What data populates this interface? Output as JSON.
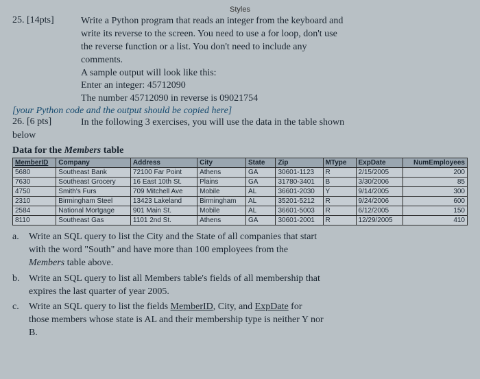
{
  "tab": "Styles",
  "q25": {
    "num": "25. [14pts]",
    "l1": "Write a Python program that reads an integer from the keyboard and",
    "l2": "write its reverse to the screen.  You need to use a for loop, don't use",
    "l3": "the reverse function or a list. You don't need to include any",
    "l4": "comments.",
    "l5": "A sample output will look like this:",
    "l6": "Enter an integer: 45712090",
    "l7": "The number 45712090 in reverse is 09021754",
    "note": "[your Python code and the output should be copied here]"
  },
  "q26": {
    "num": "26. [6 pts]",
    "l1": "In the following 3 exercises, you will use the data in the table shown",
    "below": "below",
    "heading_pre": "Data for the ",
    "heading_tbl": "Members",
    "heading_post": " table"
  },
  "headers": {
    "c0": "MemberID",
    "c1": "Company",
    "c2": "Address",
    "c3": "City",
    "c4": "State",
    "c5": "Zip",
    "c6": "MType",
    "c7": "ExpDate",
    "c8": "NumEmployees"
  },
  "rows": {
    "r0": {
      "c0": "5680",
      "c1": "Southeast Bank",
      "c2": "72100 Far Point",
      "c3": "Athens",
      "c4": "GA",
      "c5": "30601-1123",
      "c6": "R",
      "c7": "2/15/2005",
      "c8": "200"
    },
    "r1": {
      "c0": "7630",
      "c1": "Southeast Grocery",
      "c2": "16 East 10th St.",
      "c3": "Plains",
      "c4": "GA",
      "c5": "31780-3401",
      "c6": "B",
      "c7": "3/30/2006",
      "c8": "85"
    },
    "r2": {
      "c0": "4750",
      "c1": "Smith's Furs",
      "c2": "709 Mitchell Ave",
      "c3": "Mobile",
      "c4": "AL",
      "c5": "36601-2030",
      "c6": "Y",
      "c7": "9/14/2005",
      "c8": "300"
    },
    "r3": {
      "c0": "2310",
      "c1": "Birmingham Steel",
      "c2": "13423 Lakeland",
      "c3": "Birmingham",
      "c4": "AL",
      "c5": "35201-5212",
      "c6": "R",
      "c7": "9/24/2006",
      "c8": "600"
    },
    "r4": {
      "c0": "2584",
      "c1": "National Mortgage",
      "c2": "901 Main St.",
      "c3": "Mobile",
      "c4": "AL",
      "c5": "36601-5003",
      "c6": "R",
      "c7": "6/12/2005",
      "c8": "150"
    },
    "r5": {
      "c0": "8110",
      "c1": "Southeast Gas",
      "c2": "1101 2nd St.",
      "c3": "Athens",
      "c4": "GA",
      "c5": "30601-2001",
      "c6": "R",
      "c7": "12/29/2005",
      "c8": "410"
    }
  },
  "sub": {
    "a": {
      "label": "a.",
      "l1": "Write an SQL query to list the City and the State of all companies that start",
      "l2": "with the word \"South\" and have more than 100 employees from the",
      "l3a": "Members",
      "l3b": " table above."
    },
    "b": {
      "label": "b.",
      "l1": "Write an SQL query to list all Members table's fields of all membership that",
      "l2": "expires the last quarter of year 2005."
    },
    "c": {
      "label": "c.",
      "l1a": "Write an SQL query to list the fields ",
      "l1b": "MemberID",
      "l1c": ", City, and ",
      "l1d": "ExpDate",
      "l1e": " for",
      "l2": "those members whose state is AL and their membership type is neither Y nor",
      "l3": "B."
    }
  }
}
